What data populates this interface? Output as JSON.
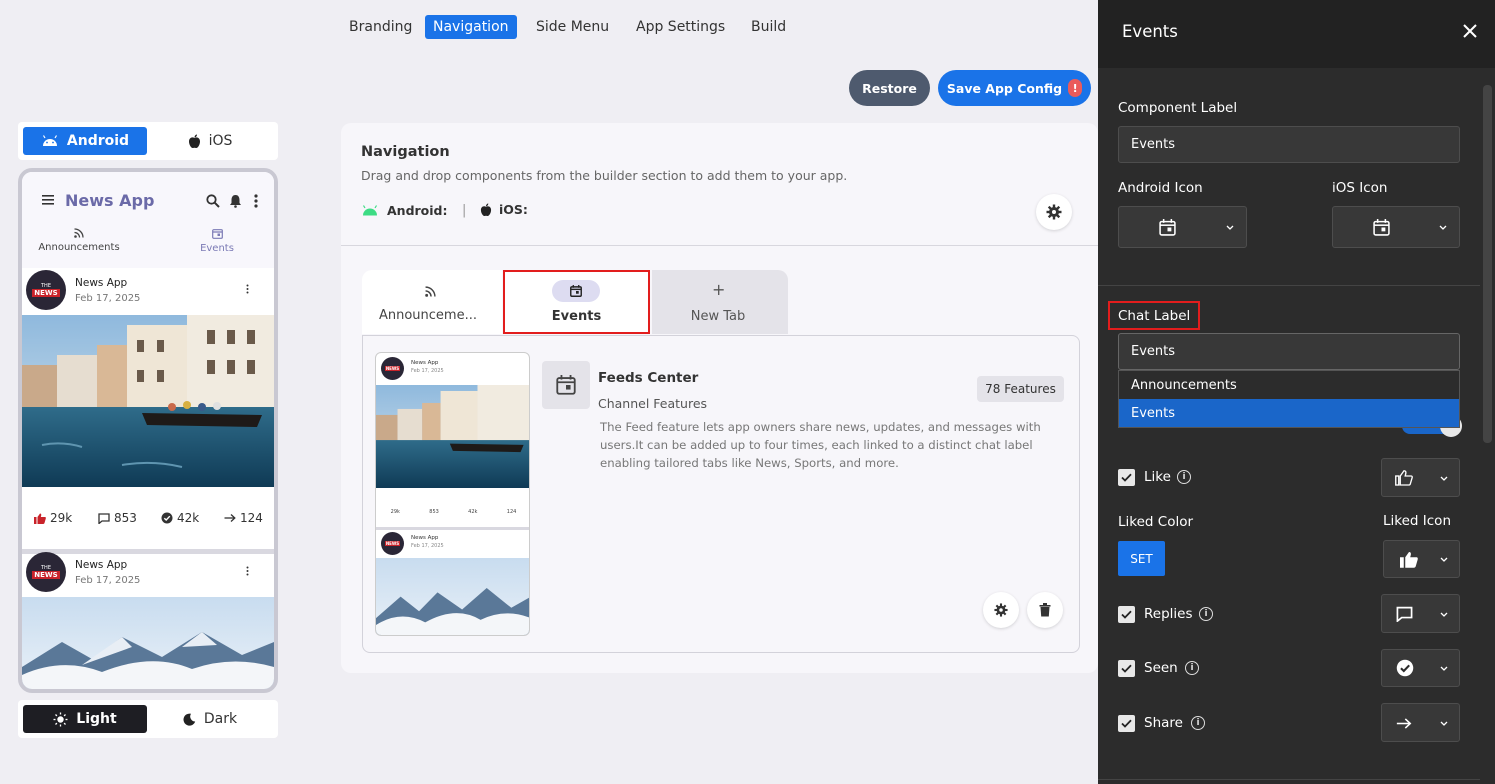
{
  "top_tabs": [
    {
      "label": "Branding"
    },
    {
      "label": "Navigation"
    },
    {
      "label": "Side Menu"
    },
    {
      "label": "App Settings"
    },
    {
      "label": "Build"
    }
  ],
  "actions": {
    "restore": "Restore",
    "save": "Save App Config",
    "save_badge": "!"
  },
  "platform": {
    "android": "Android",
    "ios": "iOS"
  },
  "theme": {
    "light": "Light",
    "dark": "Dark"
  },
  "phone": {
    "app_title": "News App",
    "tabs": [
      {
        "label": "Announcements"
      },
      {
        "label": "Events"
      }
    ],
    "posts": [
      {
        "name": "News App",
        "date": "Feb 17, 2025"
      },
      {
        "name": "News App",
        "date": "Feb 17, 2025"
      }
    ],
    "logo_text": {
      "top": "THE",
      "main": "NEWS"
    },
    "stats": {
      "likes": "29k",
      "comments": "853",
      "seen": "42k",
      "shares": "124"
    }
  },
  "navigation": {
    "title": "Navigation",
    "description": "Drag and drop components from the builder section to add them to your app.",
    "android_label": "Android:",
    "ios_label": "iOS:",
    "separator": "|",
    "tabs": [
      {
        "label": "Announceme..."
      },
      {
        "label": "Events"
      },
      {
        "label": "New Tab"
      }
    ],
    "component": {
      "title": "Feeds Center",
      "subtitle": "Channel Features",
      "badge": "78 Features",
      "description": "The Feed feature lets app owners share news, updates, and messages with users.It can be added up to four times, each linked to a distinct chat label enabling tailored tabs like News, Sports, and more."
    },
    "mini_preview": {
      "name": "News App",
      "date": "Feb 17, 2025",
      "stats": [
        "29k",
        "853",
        "42k",
        "124"
      ]
    }
  },
  "panel": {
    "title": "Events",
    "component_label": "Component Label",
    "component_value": "Events",
    "android_icon": "Android Icon",
    "ios_icon": "iOS Icon",
    "chat_label": "Chat Label",
    "chat_value": "Events",
    "dropdown_options": [
      {
        "label": "Announcements"
      },
      {
        "label": "Events"
      }
    ],
    "like": "Like",
    "liked_color": "Liked Color",
    "set_button": "SET",
    "liked_icon": "Liked Icon",
    "replies": "Replies",
    "seen": "Seen",
    "share": "Share"
  },
  "colors": {
    "accent": "#1a73e8",
    "highlight": "#e21d1d",
    "panel": "#2c2c2c"
  }
}
